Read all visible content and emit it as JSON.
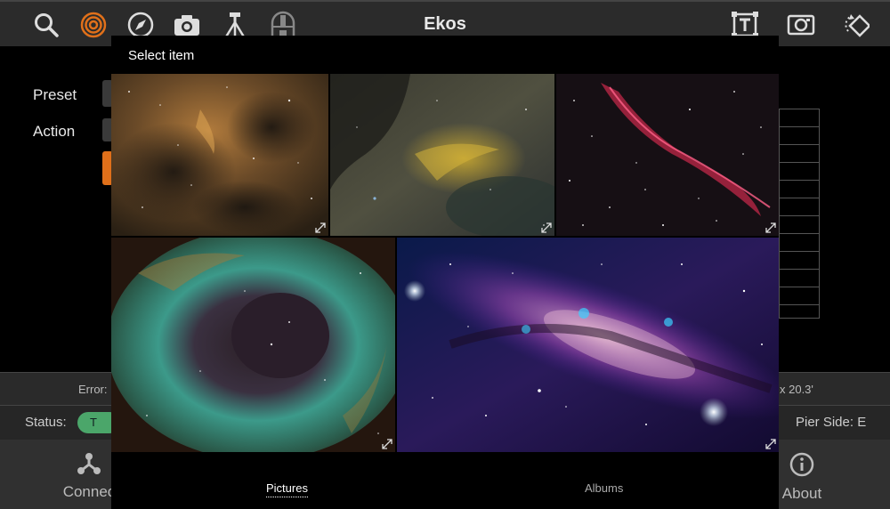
{
  "app": {
    "title": "Ekos"
  },
  "toolbar": {
    "icons": [
      "search-icon",
      "target-icon",
      "compass-icon",
      "camera-icon",
      "telescope-icon",
      "observatory-icon",
      "text-frame-icon",
      "capture-frame-icon",
      "rotate-icon"
    ]
  },
  "background": {
    "preset_label": "Preset",
    "action_label": "Action",
    "error_label": "Error:",
    "error_value": "x 20.3'",
    "status_label": "Status:",
    "status_pill_text": "T",
    "pier_side": "Pier Side: E",
    "nav": {
      "connect_label": "Connec",
      "about_label": "About"
    }
  },
  "picker": {
    "title": "Select item",
    "images": [
      {
        "name": "elephant-trunk-nebula",
        "alt": ""
      },
      {
        "name": "pelican-nebula",
        "alt": ""
      },
      {
        "name": "veil-nebula",
        "alt": ""
      },
      {
        "name": "rosette-nebula",
        "alt": ""
      },
      {
        "name": "milky-way-core",
        "alt": ""
      }
    ],
    "tabs": {
      "pictures": "Pictures",
      "albums": "Albums",
      "active": "Pictures"
    }
  },
  "colors": {
    "accent": "#e0701a",
    "status_green": "#4ba66a",
    "toolbar_bg": "#2b2b2b"
  }
}
